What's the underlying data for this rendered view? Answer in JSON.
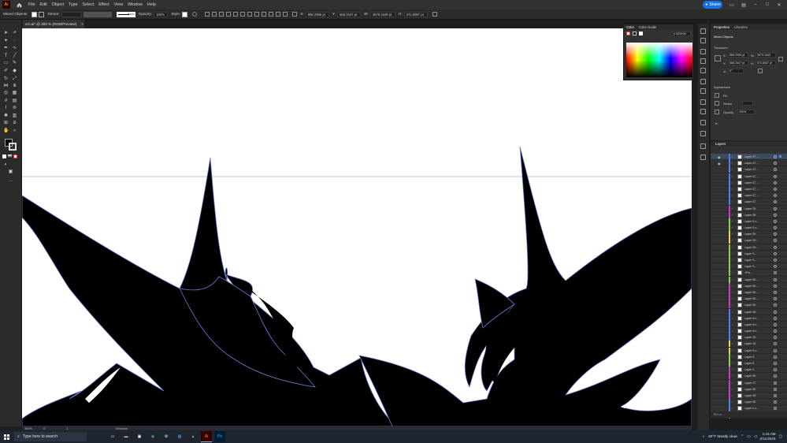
{
  "menubar": {
    "logo": "Ai",
    "menus": [
      "File",
      "Edit",
      "Object",
      "Type",
      "Select",
      "Effect",
      "View",
      "Window",
      "Help"
    ],
    "share_label": "Share"
  },
  "controlbar": {
    "selection_type": "Mixed Objects",
    "stroke_label": "Stroke:",
    "stroke_profile": "Basic",
    "opacity_label": "Opacity:",
    "opacity_value": "100%",
    "style_label": "Style:",
    "x_value": "868.2995 pt",
    "y_value": "568.1547 pt",
    "w_value": "3679.1649 pt",
    "h_value": "572.8087 pt"
  },
  "document": {
    "tab_title": "crn.ai* @ 300 % (RGB/Preview)",
    "close_glyph": "×"
  },
  "statusbar": {
    "zoom": "300%",
    "rotation": "0°",
    "artboard": "1",
    "tool": "Selection"
  },
  "color_panel": {
    "tabs": [
      "Color",
      "Color Guide"
    ],
    "hex": "000000"
  },
  "properties": {
    "tabs": [
      "Properties",
      "Libraries"
    ],
    "selection": "Mixed Objects",
    "transform_label": "Transform",
    "x": "868.2995 pt",
    "y": "568.1547 pt",
    "w": "3679.1649",
    "h": "572.8087 pt",
    "angle": "0°",
    "appearance_label": "Appearance",
    "fill_label": "Fill",
    "stroke_label": "Stroke",
    "opacity_label": "Opacity",
    "opacity_value": "100%",
    "fx_label": "fx."
  },
  "layers": {
    "tab": "Layers",
    "footer": "91 La...",
    "rows": [
      {
        "name": "Layer 47 ...",
        "color": "#4f7fff",
        "selected": true,
        "eye": true
      },
      {
        "name": "Layer 47 ...",
        "color": "#4f7fff",
        "selected": false,
        "eye": true
      },
      {
        "name": "Layer 47 ...",
        "color": "#4f7fff",
        "selected": false,
        "eye": false
      },
      {
        "name": "Layer 47 ...",
        "color": "#4f7fff",
        "selected": false,
        "eye": false
      },
      {
        "name": "Layer 47 ...",
        "color": "#4f7fff",
        "selected": false,
        "eye": false
      },
      {
        "name": "Layer 47 ...",
        "color": "#4f7fff",
        "selected": false,
        "eye": false
      },
      {
        "name": "Layer 47 ...",
        "color": "#4f7fff",
        "selected": false,
        "eye": false
      },
      {
        "name": "Layer 47",
        "color": "#4f7fff",
        "selected": false,
        "eye": false
      },
      {
        "name": "Layer 29",
        "color": "#c83cc8",
        "selected": false,
        "eye": false
      },
      {
        "name": "Layer 28",
        "color": "#c83cc8",
        "selected": false,
        "eye": false
      },
      {
        "name": "Layer 9 c...",
        "color": "#8fd14f",
        "selected": false,
        "eye": false
      },
      {
        "name": "Layer 9 c...",
        "color": "#8fd14f",
        "selected": false,
        "eye": false
      },
      {
        "name": "Layer 39",
        "color": "#e8d84a",
        "selected": false,
        "eye": false
      },
      {
        "name": "Layer 39 ...",
        "color": "#e8d84a",
        "selected": false,
        "eye": false
      },
      {
        "name": "Layer 39 ...",
        "color": "#8fd14f",
        "selected": false,
        "eye": false
      },
      {
        "name": "Layer 3...",
        "color": "#8fd14f",
        "selected": false,
        "eye": false
      },
      {
        "name": "Layer 3...",
        "color": "#8fd14f",
        "selected": false,
        "eye": false
      },
      {
        "name": "Layer 3...",
        "color": "#8fd14f",
        "selected": false,
        "eye": false
      },
      {
        "name": "<Pa...",
        "color": "#8fd14f",
        "selected": false,
        "eye": false
      },
      {
        "name": "Layer 39 ...",
        "color": "#8fd14f",
        "selected": false,
        "eye": false
      },
      {
        "name": "Layer 39 ...",
        "color": "#c83cc8",
        "selected": false,
        "eye": false
      },
      {
        "name": "Layer 39 ...",
        "color": "#c83cc8",
        "selected": false,
        "eye": false
      },
      {
        "name": "Layer 39 ...",
        "color": "#c83cc8",
        "selected": false,
        "eye": false
      },
      {
        "name": "Layer 39",
        "color": "#c83cc8",
        "selected": false,
        "eye": false
      },
      {
        "name": "Layer 18",
        "color": "#4f7fff",
        "selected": false,
        "eye": false
      },
      {
        "name": "Layer 9 c...",
        "color": "#4f7fff",
        "selected": false,
        "eye": false
      },
      {
        "name": "Layer 9 c...",
        "color": "#4f7fff",
        "selected": false,
        "eye": false
      },
      {
        "name": "Layer 9 c...",
        "color": "#4f7fff",
        "selected": false,
        "eye": false
      },
      {
        "name": "Layer 16",
        "color": "#4f7fff",
        "selected": false,
        "eye": false
      },
      {
        "name": "Layer 15",
        "color": "#e8d84a",
        "selected": false,
        "eye": false
      },
      {
        "name": "Layer 9 c...",
        "color": "#e8d84a",
        "selected": false,
        "eye": false
      },
      {
        "name": "Layer 9",
        "color": "#8fd14f",
        "selected": false,
        "eye": false
      },
      {
        "name": "Layer 8",
        "color": "#8fd14f",
        "selected": false,
        "eye": false
      },
      {
        "name": "Layer 1",
        "color": "#c83cc8",
        "selected": false,
        "eye": false
      },
      {
        "name": "Layer 25",
        "color": "#c83cc8",
        "selected": false,
        "eye": false
      },
      {
        "name": "Layer 27",
        "color": "#c83cc8",
        "selected": false,
        "eye": false
      },
      {
        "name": "Layer 35",
        "color": "#c83cc8",
        "selected": false,
        "eye": false
      },
      {
        "name": "Layer 33",
        "color": "#c83cc8",
        "selected": false,
        "eye": false
      },
      {
        "name": "Layer 36",
        "color": "#4f7fff",
        "selected": false,
        "eye": false
      },
      {
        "name": "Layer 4 c...",
        "color": "#4f7fff",
        "selected": false,
        "eye": false
      },
      {
        "name": "Layer 4 c...",
        "color": "#4f7fff",
        "selected": false,
        "eye": false
      }
    ]
  },
  "taskbar": {
    "search_placeholder": "Type here to search",
    "weather": "40°F  Mostly clear",
    "time": "1:16 AM",
    "date": "2/11/2023",
    "apps": [
      "Ai",
      "Ps"
    ]
  },
  "colors": {
    "accent": "#1473e6",
    "selection_outline": "#6a7bd8",
    "canvas": "#ffffff",
    "artwork": "#000000"
  }
}
